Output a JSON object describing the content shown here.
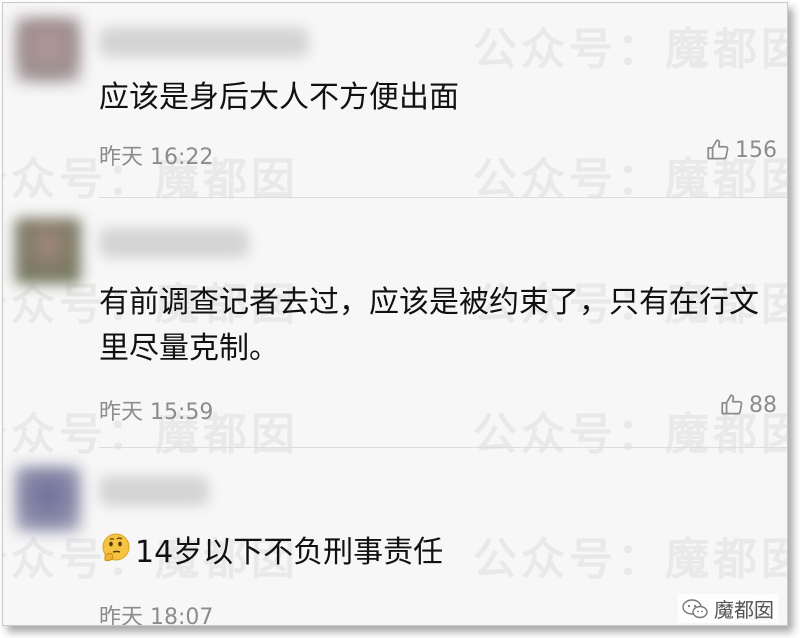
{
  "watermark": {
    "text": "公众号：魔都囡"
  },
  "comments": [
    {
      "text": "应该是身后大人不方便出面",
      "time": "昨天 16:22",
      "likes": "156"
    },
    {
      "text": "有前调查记者去过，应该是被约束了，只有在行文里尽量克制。",
      "time": "昨天 15:59",
      "likes": "88"
    },
    {
      "text": "14岁以下不负刑事责任",
      "time": "昨天 18:07",
      "likes": ""
    }
  ],
  "brand": {
    "name": "魔都囡"
  },
  "icons": {
    "like": "thumbs-up-icon",
    "emoji": "thinking-face-icon",
    "brand": "wechat-icon"
  },
  "colors": {
    "background": "#f7f7f7",
    "text": "#111111",
    "meta": "#8c8c8c"
  }
}
